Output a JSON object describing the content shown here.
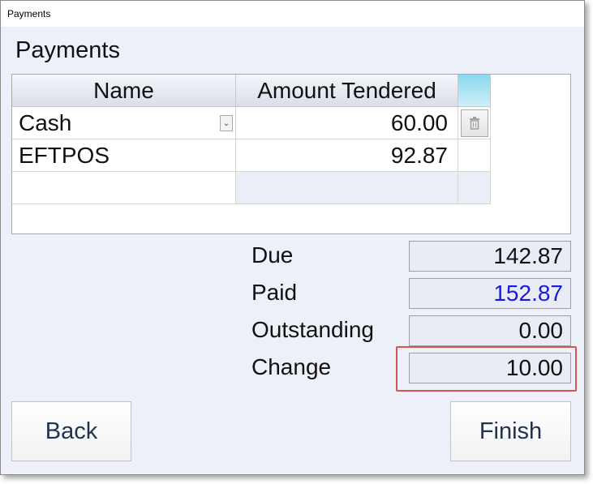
{
  "window": {
    "title": "Payments"
  },
  "heading": "Payments",
  "grid": {
    "columns": {
      "name": "Name",
      "amount": "Amount Tendered"
    },
    "rows": [
      {
        "name": "Cash",
        "amount": "60.00"
      },
      {
        "name": "EFTPOS",
        "amount": "92.87"
      }
    ]
  },
  "icons": {
    "dropdown": "chevron-down-icon",
    "delete": "trash-icon"
  },
  "totals": {
    "due": {
      "label": "Due",
      "value": "142.87"
    },
    "paid": {
      "label": "Paid",
      "value": "152.87"
    },
    "outstanding": {
      "label": "Outstanding",
      "value": "0.00"
    },
    "change": {
      "label": "Change",
      "value": "10.00"
    }
  },
  "colors": {
    "paid_value": "#1a1adc",
    "highlight": "#d9534f",
    "action_header": "#87d8ef"
  },
  "buttons": {
    "back": "Back",
    "finish": "Finish"
  }
}
